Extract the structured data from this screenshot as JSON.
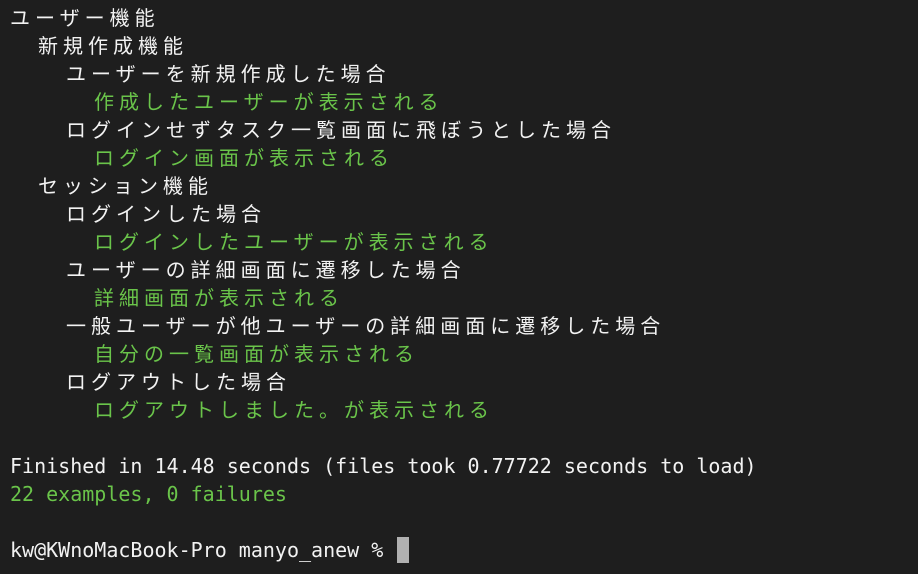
{
  "output": [
    {
      "text": "ユーザー機能",
      "indent": 0,
      "color": "white"
    },
    {
      "text": "新規作成機能",
      "indent": 1,
      "color": "white"
    },
    {
      "text": "ユーザーを新規作成した場合",
      "indent": 2,
      "color": "white"
    },
    {
      "text": "作成したユーザーが表示される",
      "indent": 3,
      "color": "green"
    },
    {
      "text": "ログインせずタスク一覧画面に飛ぼうとした場合",
      "indent": 2,
      "color": "white"
    },
    {
      "text": "ログイン画面が表示される",
      "indent": 3,
      "color": "green"
    },
    {
      "text": "セッション機能",
      "indent": 1,
      "color": "white"
    },
    {
      "text": "ログインした場合",
      "indent": 2,
      "color": "white"
    },
    {
      "text": "ログインしたユーザーが表示される",
      "indent": 3,
      "color": "green"
    },
    {
      "text": "ユーザーの詳細画面に遷移した場合",
      "indent": 2,
      "color": "white"
    },
    {
      "text": "詳細画面が表示される",
      "indent": 3,
      "color": "green"
    },
    {
      "text": "一般ユーザーが他ユーザーの詳細画面に遷移した場合",
      "indent": 2,
      "color": "white"
    },
    {
      "text": "自分の一覧画面が表示される",
      "indent": 3,
      "color": "green"
    },
    {
      "text": "ログアウトした場合",
      "indent": 2,
      "color": "white"
    },
    {
      "text": "ログアウトしました。が表示される",
      "indent": 3,
      "color": "green"
    }
  ],
  "summary": {
    "finished": "Finished in 14.48 seconds (files took 0.77722 seconds to load)",
    "result": "22 examples, 0 failures"
  },
  "prompt": {
    "text": "kw@KWnoMacBook-Pro manyo_anew % "
  },
  "colors": {
    "background": "#1e1e1e",
    "text": "#f2f2f2",
    "pass": "#6ac44a",
    "cursor": "#b0b0b0"
  }
}
